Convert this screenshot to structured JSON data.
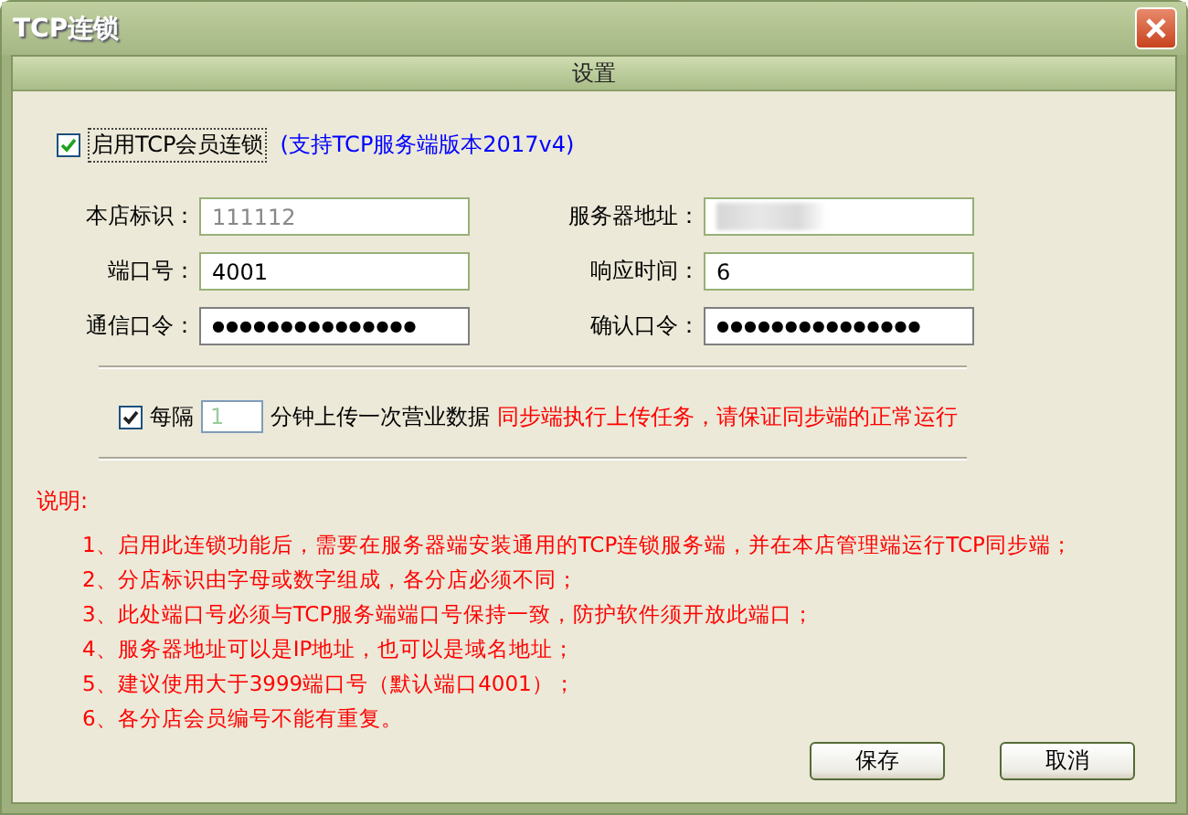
{
  "window": {
    "title": "TCP连锁"
  },
  "section_title": "设置",
  "enable": {
    "label": "启用TCP会员连锁",
    "checked": true,
    "note": "(支持TCP服务端版本2017v4)"
  },
  "fields": [
    {
      "label": "本店标识：",
      "kind": "text",
      "value": "111112",
      "disabled": true
    },
    {
      "label": "服务器地址：",
      "kind": "redacted",
      "disabled": false
    },
    {
      "label": "端口号：",
      "kind": "text",
      "value": "4001",
      "disabled": false
    },
    {
      "label": "响应时间：",
      "kind": "text",
      "value": "6",
      "disabled": false
    },
    {
      "label": "通信口令：",
      "kind": "password",
      "value": "●●●●●●●●●●●●●●●",
      "disabled": false
    },
    {
      "label": "确认口令：",
      "kind": "password",
      "value": "●●●●●●●●●●●●●●●",
      "disabled": false
    }
  ],
  "upload": {
    "checked": true,
    "prefix": "每隔",
    "value": "1",
    "disabled": true,
    "suffix": "分钟上传一次营业数据",
    "warning": "同步端执行上传任务，请保证同步端的正常运行"
  },
  "notes": {
    "title": "说明:",
    "items": [
      "1、启用此连锁功能后，需要在服务器端安装通用的TCP连锁服务端，并在本店管理端运行TCP同步端；",
      "2、分店标识由字母或数字组成，各分店必须不同；",
      "3、此处端口号必须与TCP服务端端口号保持一致，防护软件须开放此端口；",
      "4、服务器地址可以是IP地址，也可以是域名地址；",
      "5、建议使用大于3999端口号（默认端口4001）；",
      "6、各分店会员编号不能有重复。"
    ]
  },
  "buttons": [
    "保存",
    "取消"
  ]
}
